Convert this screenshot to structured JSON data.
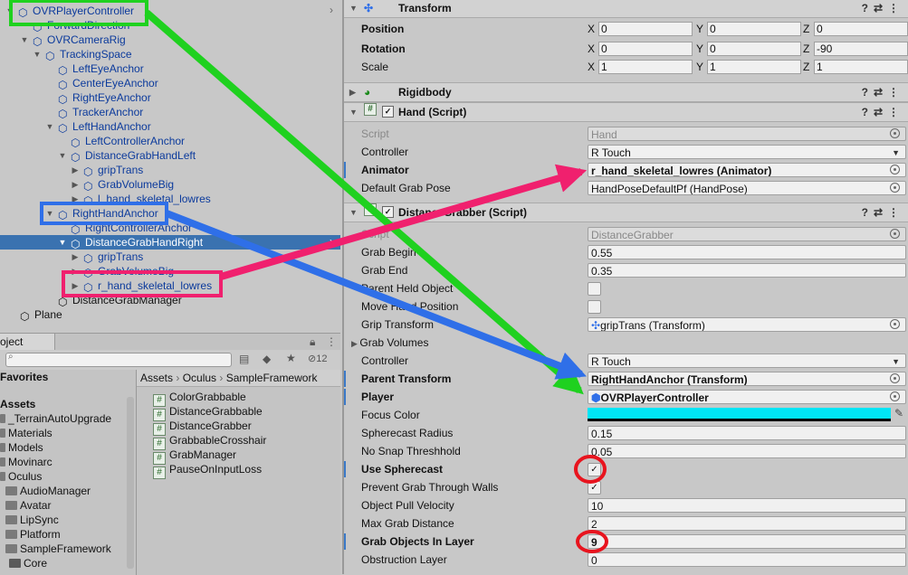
{
  "hierarchy": {
    "items": [
      {
        "label": "OVRPlayerController"
      },
      {
        "label": "ForwardDirection"
      },
      {
        "label": "OVRCameraRig"
      },
      {
        "label": "TrackingSpace"
      },
      {
        "label": "LeftEyeAnchor"
      },
      {
        "label": "CenterEyeAnchor"
      },
      {
        "label": "RightEyeAnchor"
      },
      {
        "label": "TrackerAnchor"
      },
      {
        "label": "LeftHandAnchor"
      },
      {
        "label": "LeftControllerAnchor"
      },
      {
        "label": "DistanceGrabHandLeft"
      },
      {
        "label": "gripTrans"
      },
      {
        "label": "GrabVolumeBig"
      },
      {
        "label": "l_hand_skeletal_lowres"
      },
      {
        "label": "RightHandAnchor"
      },
      {
        "label": "RightControllerAnchor"
      },
      {
        "label": "DistanceGrabHandRight"
      },
      {
        "label": "gripTrans"
      },
      {
        "label": "GrabVolumeBig"
      },
      {
        "label": "r_hand_skeletal_lowres"
      },
      {
        "label": "DistanceGrabManager"
      },
      {
        "label": "Plane"
      }
    ]
  },
  "project": {
    "tab_label": "oject",
    "count": "12",
    "favorites_label": "Favorites",
    "assets_label": "Assets",
    "breadcrumb": [
      "Assets",
      "Oculus",
      "SampleFramework"
    ],
    "folders": [
      "_TerrainAutoUpgrade",
      "Materials",
      "Models",
      "Movinarc",
      "Oculus",
      "AudioManager",
      "Avatar",
      "LipSync",
      "Platform",
      "SampleFramework",
      "Core"
    ],
    "files": [
      "ColorGrabbable",
      "DistanceGrabbable",
      "DistanceGrabber",
      "GrabbableCrosshair",
      "GrabManager",
      "PauseOnInputLoss"
    ]
  },
  "inspector": {
    "transform": {
      "title": "Transform",
      "position_label": "Position",
      "rotation_label": "Rotation",
      "scale_label": "Scale",
      "position": {
        "x": "0",
        "y": "0",
        "z": "0"
      },
      "rotation": {
        "x": "0",
        "y": "0",
        "z": "-90"
      },
      "scale": {
        "x": "1",
        "y": "1",
        "z": "1"
      }
    },
    "rigidbody": {
      "title": "Rigidbody"
    },
    "hand_script": {
      "title": "Hand (Script)",
      "script_label": "Script",
      "script_value": "Hand",
      "controller_label": "Controller",
      "controller_value": "R Touch",
      "animator_label": "Animator",
      "animator_value": "r_hand_skeletal_lowres (Animator)",
      "grabpose_label": "Default Grab Pose",
      "grabpose_value": "HandPoseDefaultPf (HandPose)"
    },
    "grabber": {
      "title": "DistanceGrabber (Script)",
      "title_visible": "Dista          rabber (Script)",
      "script_label": "Script",
      "script_value": "DistanceGrabber",
      "grab_begin_label": "Grab Begin",
      "grab_begin": "0.55",
      "grab_end_label": "Grab End",
      "grab_end": "0.35",
      "parent_held_label": "Parent Held Object",
      "move_hand_label": "Move Hand Position",
      "grip_transform_label": "Grip Transform",
      "grip_transform": "gripTrans (Transform)",
      "grab_volumes_label": "Grab Volumes",
      "controller_label": "Controller",
      "controller_value": "R Touch",
      "parent_transform_label": "Parent Transform",
      "parent_transform": "RightHandAnchor (Transform)",
      "player_label": "Player",
      "player": "OVRPlayerController",
      "focus_color_label": "Focus Color",
      "focus_color": "#00e5f5",
      "spherecast_radius_label": "Spherecast Radius",
      "spherecast_radius": "0.15",
      "no_snap_label": "No Snap Threshhold",
      "no_snap": "0.05",
      "use_spherecast_label": "Use Spherecast",
      "prevent_grab_label": "Prevent Grab Through Walls",
      "pull_velocity_label": "Object Pull Velocity",
      "pull_velocity": "10",
      "max_grab_label": "Max Grab Distance",
      "max_grab": "2",
      "grab_layer_label": "Grab Objects In Layer",
      "grab_layer": "9",
      "obstruction_label": "Obstruction Layer",
      "obstruction": "0"
    }
  },
  "colors": {
    "green_arrow": "#1fd11f",
    "blue_arrow": "#2f6fe8",
    "pink_arrow": "#f0206e",
    "red_circle": "#e8141e",
    "selection": "#3a72b0"
  }
}
